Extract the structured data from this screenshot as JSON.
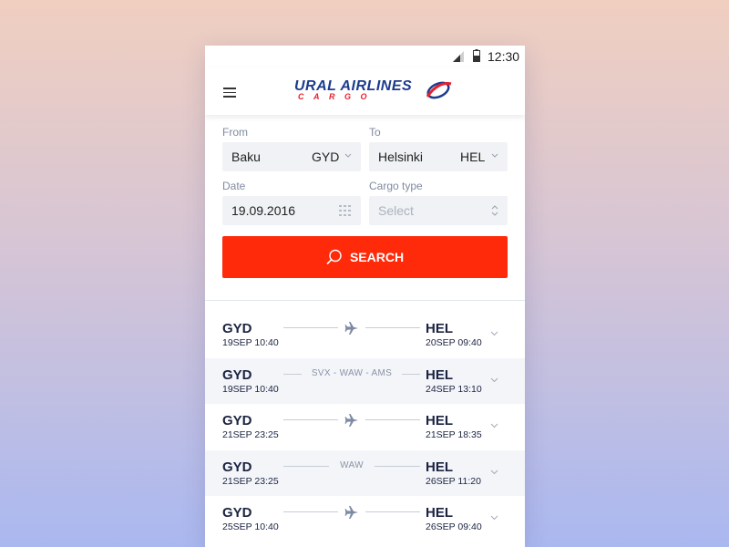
{
  "status_bar": {
    "time": "12:30"
  },
  "app_bar": {
    "logo_line1": "URAL AIRLINES",
    "logo_line2": "CARGO"
  },
  "form": {
    "from_label": "From",
    "from_city": "Baku",
    "from_code": "GYD",
    "to_label": "To",
    "to_city": "Helsinki",
    "to_code": "HEL",
    "date_label": "Date",
    "date_value": "19.09.2016",
    "cargo_label": "Cargo type",
    "cargo_placeholder": "Select",
    "search_label": "SEARCH"
  },
  "results": [
    {
      "from": "GYD",
      "from_time": "19SEP 10:40",
      "to": "HEL",
      "to_time": "20SEP 09:40",
      "via": "",
      "direct": true,
      "shaded": false
    },
    {
      "from": "GYD",
      "from_time": "19SEP 10:40",
      "to": "HEL",
      "to_time": "24SEP 13:10",
      "via": "SVX - WAW - AMS",
      "direct": false,
      "shaded": true
    },
    {
      "from": "GYD",
      "from_time": "21SEP 23:25",
      "to": "HEL",
      "to_time": "21SEP 18:35",
      "via": "",
      "direct": true,
      "shaded": false
    },
    {
      "from": "GYD",
      "from_time": "21SEP 23:25",
      "to": "HEL",
      "to_time": "26SEP 11:20",
      "via": "WAW",
      "direct": false,
      "shaded": true
    },
    {
      "from": "GYD",
      "from_time": "25SEP 10:40",
      "to": "HEL",
      "to_time": "26SEP 09:40",
      "via": "",
      "direct": true,
      "shaded": false
    }
  ],
  "colors": {
    "accent": "#ff2a0a",
    "brand_blue": "#1d3c8f",
    "brand_red": "#e5202e",
    "text_dark": "#1b2341"
  },
  "icons": [
    "signal-icon",
    "battery-icon",
    "menu-icon",
    "logo-swoosh-icon",
    "chevron-down-icon",
    "calendar-icon",
    "sort-icon",
    "search-icon",
    "plane-icon"
  ]
}
